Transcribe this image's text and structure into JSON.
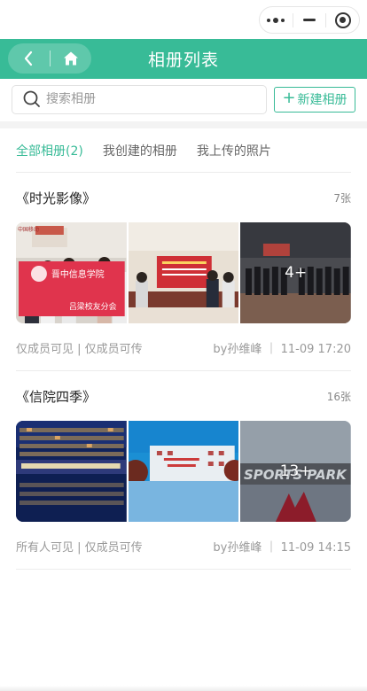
{
  "nav": {
    "title": "相册列表"
  },
  "search": {
    "placeholder": "搜索相册"
  },
  "new_album": {
    "plus": "+",
    "label": "新建相册"
  },
  "tabs": [
    {
      "label": "全部相册(2)",
      "active": true
    },
    {
      "label": "我创建的相册",
      "active": false
    },
    {
      "label": "我上传的照片",
      "active": false
    }
  ],
  "albums": [
    {
      "title": "《时光影像》",
      "count": "7张",
      "more": "4+",
      "visibility": "仅成员可见 | 仅成员可传",
      "meta": "by孙维峰 ｜ 11-09 17:20",
      "photo_text": {
        "banner_line1": "晋中信息学院",
        "banner_line2": "吕梁校友分会",
        "sign": "中国移动"
      }
    },
    {
      "title": "《信院四季》",
      "count": "16张",
      "more": "13+",
      "visibility": "所有人可见 | 仅成员可传",
      "meta": "by孙维峰 ｜ 11-09 14:15",
      "photo_text": {
        "park": "SPORTS PARK"
      }
    }
  ],
  "colors": {
    "accent": "#38bb97"
  }
}
